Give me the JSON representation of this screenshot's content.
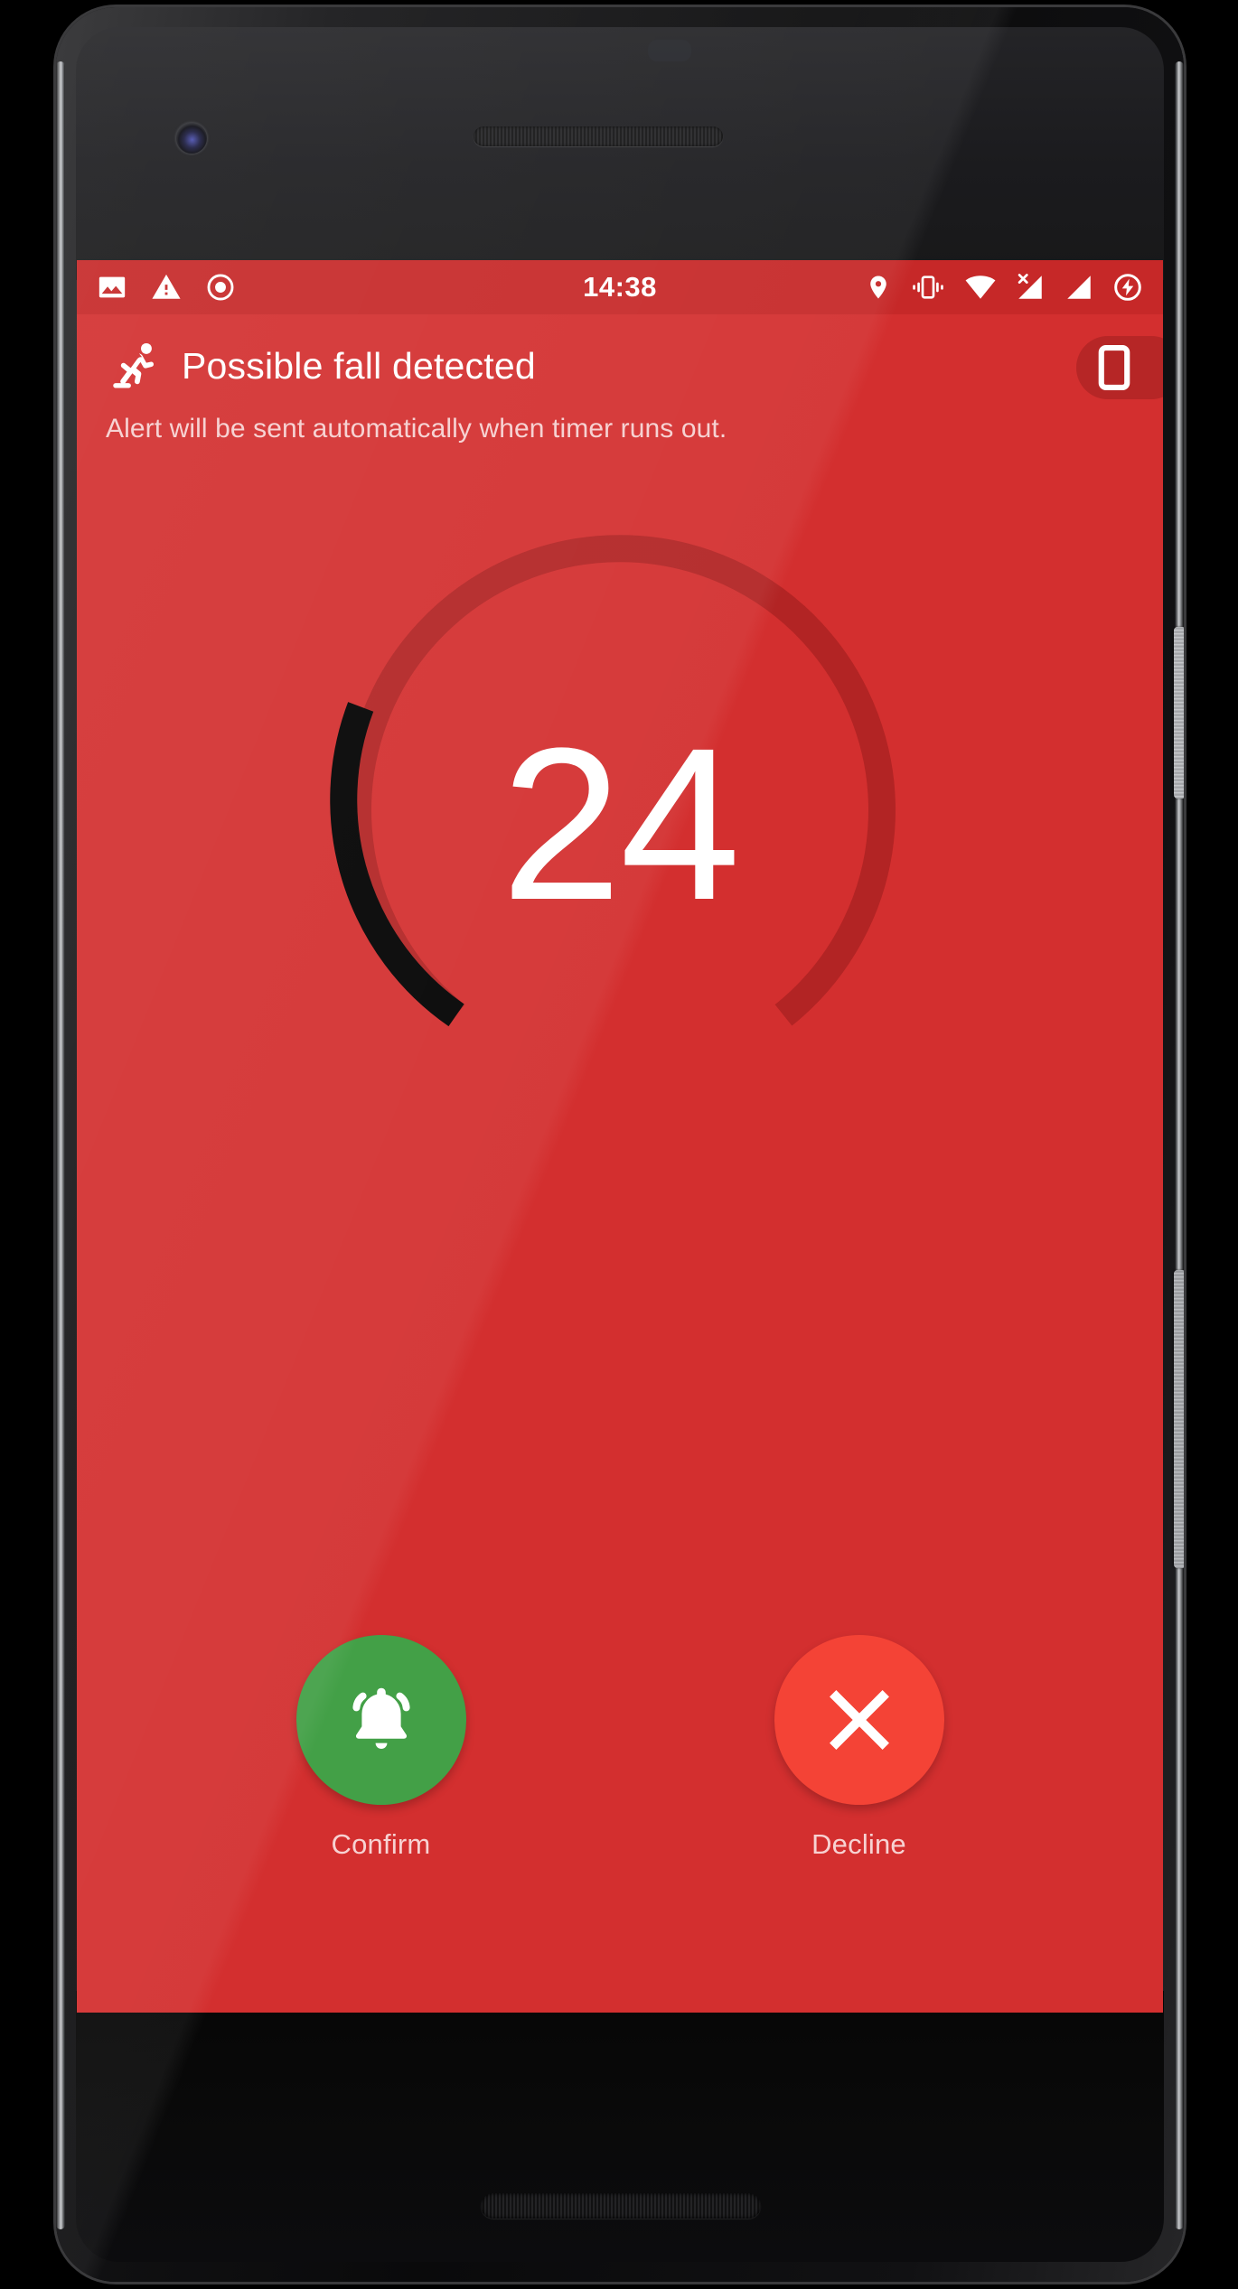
{
  "status_bar": {
    "clock": "14:38",
    "left_icons": [
      {
        "name": "image-icon",
        "glyph": "photo"
      },
      {
        "name": "warning-triangle-icon",
        "glyph": "warning"
      },
      {
        "name": "record-circle-icon",
        "glyph": "record"
      }
    ],
    "right_icons": [
      {
        "name": "location-pin-icon",
        "glyph": "location"
      },
      {
        "name": "vibrate-icon",
        "glyph": "vibrate"
      },
      {
        "name": "wifi-icon",
        "glyph": "wifi"
      },
      {
        "name": "no-sim-signal-icon",
        "glyph": "signal-off"
      },
      {
        "name": "cellular-signal-icon",
        "glyph": "signal"
      },
      {
        "name": "battery-charging-icon",
        "glyph": "battery-charging"
      }
    ],
    "background_color": "#C62828"
  },
  "app_bar": {
    "title": "Possible fall detected",
    "subtitle": "Alert will be sent automatically when timer runs out.",
    "leading_icon": "falling-person-icon",
    "action_icon": "phone-device-icon",
    "background_color": "#D32F2F"
  },
  "countdown": {
    "value": "24",
    "total_seconds": 30,
    "track_color": "#B22424",
    "progress_color": "#000000",
    "value_color": "#FFFFFF"
  },
  "actions": [
    {
      "name": "confirm",
      "label": "Confirm",
      "icon": "bell-ringing-icon",
      "color": "#43A047"
    },
    {
      "name": "decline",
      "label": "Decline",
      "icon": "close-x-icon",
      "color": "#F44336"
    }
  ],
  "screen": {
    "background_color": "#D32F2F",
    "accent_color": "#C62828"
  }
}
